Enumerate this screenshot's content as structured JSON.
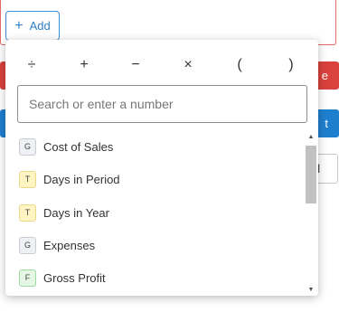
{
  "add_button": {
    "icon": "plus-icon",
    "label": "Add"
  },
  "background": {
    "red_button_fragment": "e",
    "blue_button_fragment": "t",
    "white_button_fragment": "el"
  },
  "operators": [
    "÷",
    "+",
    "−",
    "×",
    "(",
    ")"
  ],
  "search": {
    "placeholder": "Search or enter a number",
    "value": ""
  },
  "items": [
    {
      "badge": "G",
      "label": "Cost of Sales"
    },
    {
      "badge": "T",
      "label": "Days in Period"
    },
    {
      "badge": "T",
      "label": "Days in Year"
    },
    {
      "badge": "G",
      "label": "Expenses"
    },
    {
      "badge": "F",
      "label": "Gross Profit"
    }
  ]
}
